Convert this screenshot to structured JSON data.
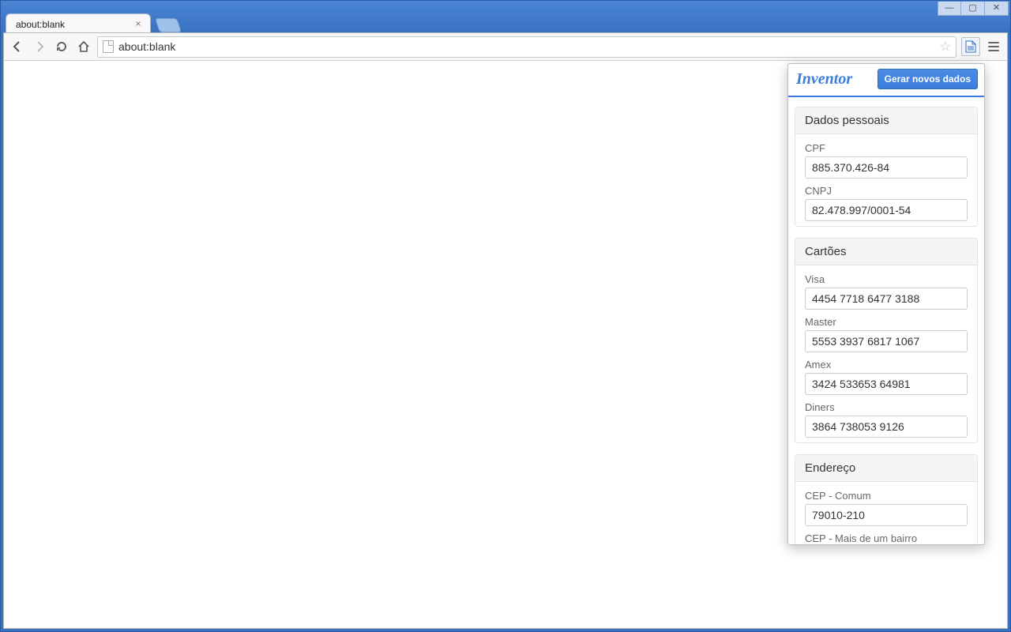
{
  "window": {
    "tab_title": "about:blank",
    "url": "about:blank"
  },
  "popup": {
    "title": "Inventor",
    "generate_label": "Gerar novos dados",
    "sections": [
      {
        "title": "Dados pessoais",
        "fields": [
          {
            "label": "CPF",
            "value": "885.370.426-84"
          },
          {
            "label": "CNPJ",
            "value": "82.478.997/0001-54"
          }
        ]
      },
      {
        "title": "Cartões",
        "fields": [
          {
            "label": "Visa",
            "value": "4454 7718 6477 3188"
          },
          {
            "label": "Master",
            "value": "5553 3937 6817 1067"
          },
          {
            "label": "Amex",
            "value": "3424 533653 64981"
          },
          {
            "label": "Diners",
            "value": "3864 738053 9126"
          }
        ]
      },
      {
        "title": "Endereço",
        "fields": [
          {
            "label": "CEP - Comum",
            "value": "79010-210"
          },
          {
            "label": "CEP - Mais de um bairro",
            "value": ""
          }
        ]
      }
    ]
  }
}
